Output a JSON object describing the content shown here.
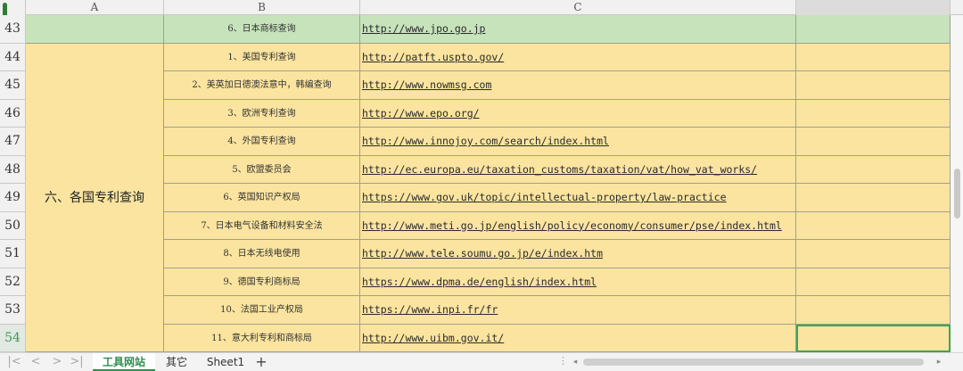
{
  "columns": [
    "A",
    "B",
    "C"
  ],
  "merged_a_label": "六、各国专利查询",
  "rows": [
    {
      "num": "43",
      "b": "6、日本商标查询",
      "c": "http://www.jpo.go.jp",
      "fill": "green"
    },
    {
      "num": "44",
      "b": "1、美国专利查询",
      "c": "http://patft.uspto.gov/",
      "fill": "yellow"
    },
    {
      "num": "45",
      "b": "2、美英加日德澳法意中，韩编查询",
      "c": "http://www.nowmsg.com",
      "fill": "yellow"
    },
    {
      "num": "46",
      "b": "3、欧洲专利查询",
      "c": "http://www.epo.org/",
      "fill": "yellow"
    },
    {
      "num": "47",
      "b": "4、外国专利查询",
      "c": "http://www.innojoy.com/search/index.html",
      "fill": "yellow"
    },
    {
      "num": "48",
      "b": "5、欧盟委员会",
      "c": "http://ec.europa.eu/taxation_customs/taxation/vat/how_vat_works/",
      "fill": "yellow"
    },
    {
      "num": "49",
      "b": "6、英国知识产权局",
      "c": "https://www.gov.uk/topic/intellectual-property/law-practice",
      "fill": "yellow"
    },
    {
      "num": "50",
      "b": "7、日本电气设备和材料安全法",
      "c": "http://www.meti.go.jp/english/policy/economy/consumer/pse/index.html",
      "fill": "yellow"
    },
    {
      "num": "51",
      "b": "8、日本无线电使用",
      "c": "http://www.tele.soumu.go.jp/e/index.htm",
      "fill": "yellow"
    },
    {
      "num": "52",
      "b": "9、德国专利商标局",
      "c": "https://www.dpma.de/english/index.html",
      "fill": "yellow"
    },
    {
      "num": "53",
      "b": "10、法国工业产权局",
      "c": "https://www.inpi.fr/fr",
      "fill": "yellow"
    },
    {
      "num": "54",
      "b": "11、意大利专利和商标局",
      "c": "http://www.uibm.gov.it/",
      "fill": "yellow"
    }
  ],
  "active_row": "54",
  "sheet_tabs": [
    {
      "label": "工具网站",
      "active": true
    },
    {
      "label": "其它",
      "active": false
    },
    {
      "label": "Sheet1",
      "active": false
    }
  ],
  "add_tab_label": "+",
  "nav_icons": [
    "first-sheet-icon",
    "prev-sheet-icon",
    "next-sheet-icon",
    "last-sheet-icon"
  ],
  "colors": {
    "yellow_fill": "#fbe49f",
    "green_fill": "#c6e3bb",
    "accent": "#2f8f4e"
  }
}
